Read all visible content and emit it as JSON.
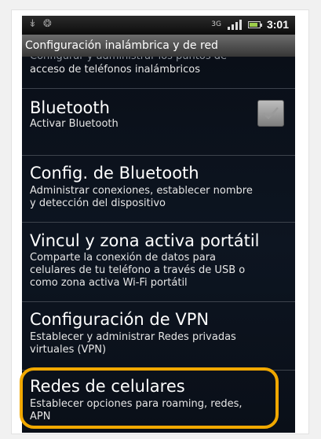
{
  "status_bar": {
    "left_icons": [
      "usb-icon",
      "android-icon"
    ],
    "network": "3G",
    "time": "3:01"
  },
  "header": {
    "title": "Configuración inalámbrica y de red"
  },
  "settings": {
    "partial_top": {
      "subtitle_line1": "Configurar y administrar los puntos de",
      "subtitle_line2": "acceso de teléfonos inalámbricos"
    },
    "bluetooth": {
      "title": "Bluetooth",
      "subtitle": "Activar Bluetooth",
      "checked": true
    },
    "bluetooth_config": {
      "title": "Config. de Bluetooth",
      "subtitle_line1": "Administrar conexiones, establecer nombre",
      "subtitle_line2": "y detección del dispositivo"
    },
    "tethering": {
      "title": "Vincul y zona activa portátil",
      "subtitle_line1": "Comparte la conexión de datos para",
      "subtitle_line2": "celulares de tu teléfono a través de USB o",
      "subtitle_line3": "como zona activa Wi-Fi portátil"
    },
    "vpn": {
      "title": "Configuración de VPN",
      "subtitle_line1": "Establecer y administrar Redes privadas",
      "subtitle_line2": "virtuales (VPN)"
    },
    "mobile_networks": {
      "title": "Redes de celulares",
      "subtitle_line1": "Establecer opciones para roaming, redes,",
      "subtitle_line2": "APN"
    }
  },
  "colors": {
    "highlight": "#f1a800",
    "list_background": "#0b111b",
    "divider": "#3d434c"
  }
}
